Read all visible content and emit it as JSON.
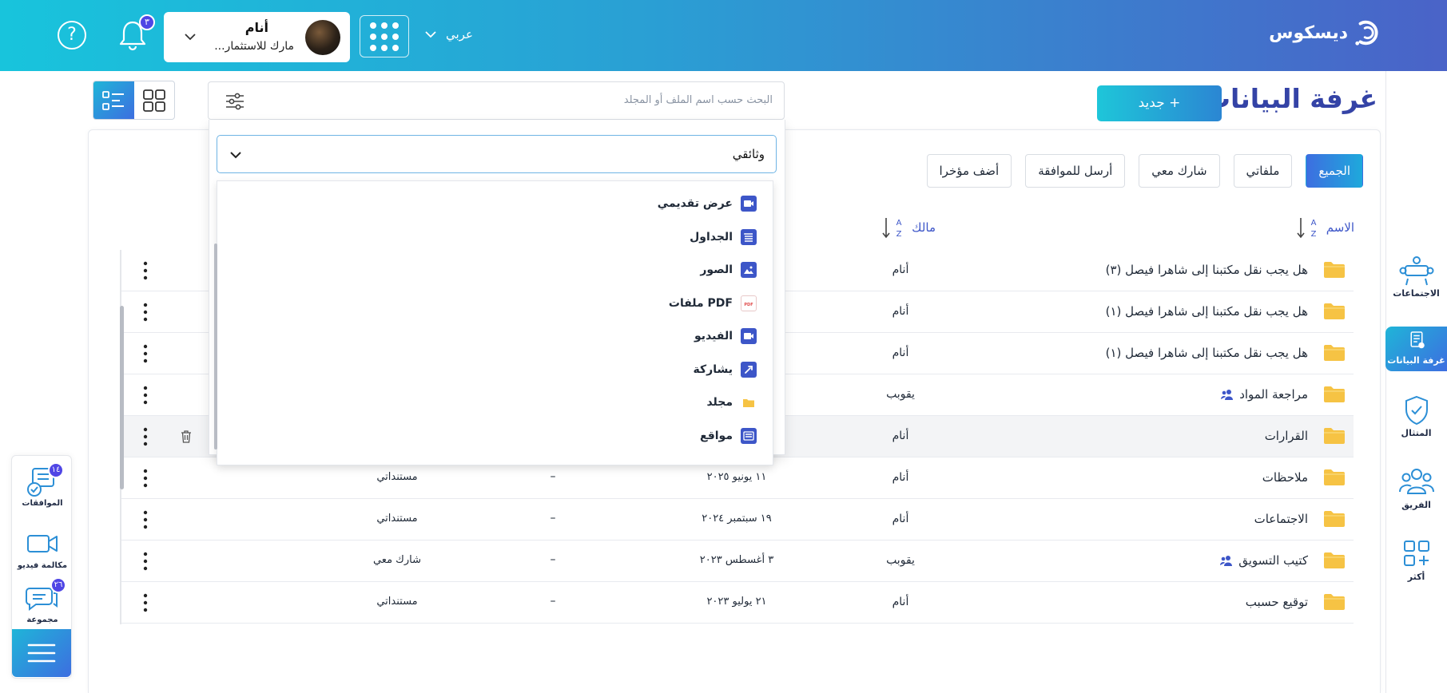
{
  "header": {
    "brand": "ديسكوس",
    "help_icon": "question-icon",
    "notification_count": "٣",
    "user": {
      "name": "أنام",
      "org": "مارك للاستثمار..."
    },
    "language": "عربي"
  },
  "rail": {
    "items": [
      {
        "label": "الاجتماعات",
        "icon": "meetings-icon"
      },
      {
        "label": "غرفة البيانات",
        "icon": "data-room-icon",
        "active": true
      },
      {
        "label": "المتثال",
        "icon": "shield-icon"
      },
      {
        "label": "الفريق",
        "icon": "team-icon"
      },
      {
        "label": "أكثر",
        "icon": "grid-plus-icon"
      }
    ]
  },
  "page": {
    "title": "غرفة البيانات",
    "new_button": "+ جديد",
    "search_placeholder": "البحث حسب اسم الملف أو المجلد"
  },
  "tabs": [
    {
      "label": "الجميع",
      "active": true
    },
    {
      "label": "ملفاتي"
    },
    {
      "label": "شارك معي"
    },
    {
      "label": "أرسل للموافقة"
    },
    {
      "label": "أضف مؤخرا"
    }
  ],
  "columns": {
    "name": "الاسم",
    "owner": "مالك"
  },
  "rows": [
    {
      "name": "هل يجب نقل مكتبنا إلى شاهرا فيصل (٣)",
      "owner": "أنام",
      "date": "",
      "size": "",
      "location": "",
      "shared": false
    },
    {
      "name": "هل يجب نقل مكتبنا إلى شاهرا فيصل (١)",
      "owner": "أنام",
      "date": "",
      "size": "",
      "location": "",
      "shared": false
    },
    {
      "name": "هل يجب نقل مكتبنا إلى شاهرا فيصل (١)",
      "owner": "أنام",
      "date": "",
      "size": "",
      "location": "",
      "shared": false
    },
    {
      "name": "مراجعة المواد",
      "owner": "يقوبب",
      "date": "",
      "size": "",
      "location": "",
      "shared": true
    },
    {
      "name": "القرارات",
      "owner": "أنام",
      "date": "",
      "size": "",
      "location": "",
      "shared": false,
      "highlighted": true
    },
    {
      "name": "ملاحظات",
      "owner": "أنام",
      "date": "١١ يونيو ٢٠٢٥",
      "size": "–",
      "location": "مستنداتي",
      "shared": false
    },
    {
      "name": "الاجتماعات",
      "owner": "أنام",
      "date": "١٩ سبتمبر ٢٠٢٤",
      "size": "–",
      "location": "مستنداتي",
      "shared": false
    },
    {
      "name": "كتيب التسويق",
      "owner": "يقوبب",
      "date": "٣ أغسطس ٢٠٢٣",
      "size": "–",
      "location": "شارك معي",
      "shared": true
    },
    {
      "name": "توقيع حسبب",
      "owner": "أنام",
      "date": "٢١ يوليو ٢٠٢٣",
      "size": "–",
      "location": "مستنداتي",
      "shared": false
    }
  ],
  "dropdown": {
    "selected": "وثائقي",
    "options": [
      {
        "label": "عرض تقديمي",
        "icon": "presentation-icon",
        "color": "#3d56c8"
      },
      {
        "label": "الجداول",
        "icon": "spreadsheet-icon",
        "color": "#3d56c8"
      },
      {
        "label": "الصور",
        "icon": "image-icon",
        "color": "#3d56c8"
      },
      {
        "label": "ملفات PDF",
        "icon": "pdf-icon",
        "color": "#e14b4b"
      },
      {
        "label": "الفيديو",
        "icon": "video-icon",
        "color": "#3d56c8"
      },
      {
        "label": "يشاركة",
        "icon": "share-link-icon",
        "color": "#3d56c8"
      },
      {
        "label": "مجلد",
        "icon": "folder-icon",
        "color": "#f6c344"
      },
      {
        "label": "مواقع",
        "icon": "sites-icon",
        "color": "#3d56c8"
      }
    ]
  },
  "float_panel": {
    "items": [
      {
        "label": "الموافقات",
        "badge": "١٤"
      },
      {
        "label": "مكالمة فيديو",
        "badge": ""
      },
      {
        "label": "مجموعة",
        "badge": "٢٦"
      }
    ]
  },
  "colors": {
    "accent": "#3d56c8",
    "header_start": "#18c4dc",
    "header_end": "#4a63c8",
    "folder": "#f6c344"
  }
}
